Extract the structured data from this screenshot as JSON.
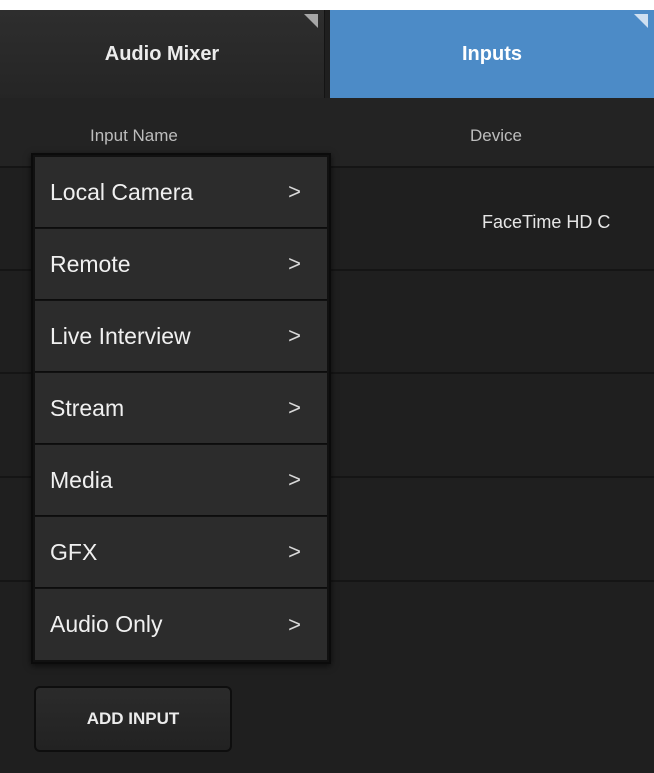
{
  "tabs": [
    {
      "label": "Audio Mixer",
      "active": false
    },
    {
      "label": "Inputs",
      "active": true
    }
  ],
  "table": {
    "headers": {
      "input_name": "Input Name",
      "device": "Device"
    },
    "rows": [
      {
        "device": "FaceTime HD C"
      },
      {
        "device": ""
      },
      {
        "device": ""
      },
      {
        "device": ""
      },
      {
        "device": ""
      }
    ]
  },
  "menu": {
    "items": [
      {
        "label": "Local Camera",
        "arrow": ">"
      },
      {
        "label": "Remote",
        "arrow": ">"
      },
      {
        "label": "Live Interview",
        "arrow": ">"
      },
      {
        "label": "Stream",
        "arrow": ">"
      },
      {
        "label": "Media",
        "arrow": ">"
      },
      {
        "label": "GFX",
        "arrow": ">"
      },
      {
        "label": "Audio Only",
        "arrow": ">"
      }
    ]
  },
  "footer": {
    "add_button_label": "ADD INPUT"
  },
  "colors": {
    "active_tab": "#4c8bc7",
    "background": "#1f1f1f",
    "menu_item": "#2c2c2c"
  }
}
